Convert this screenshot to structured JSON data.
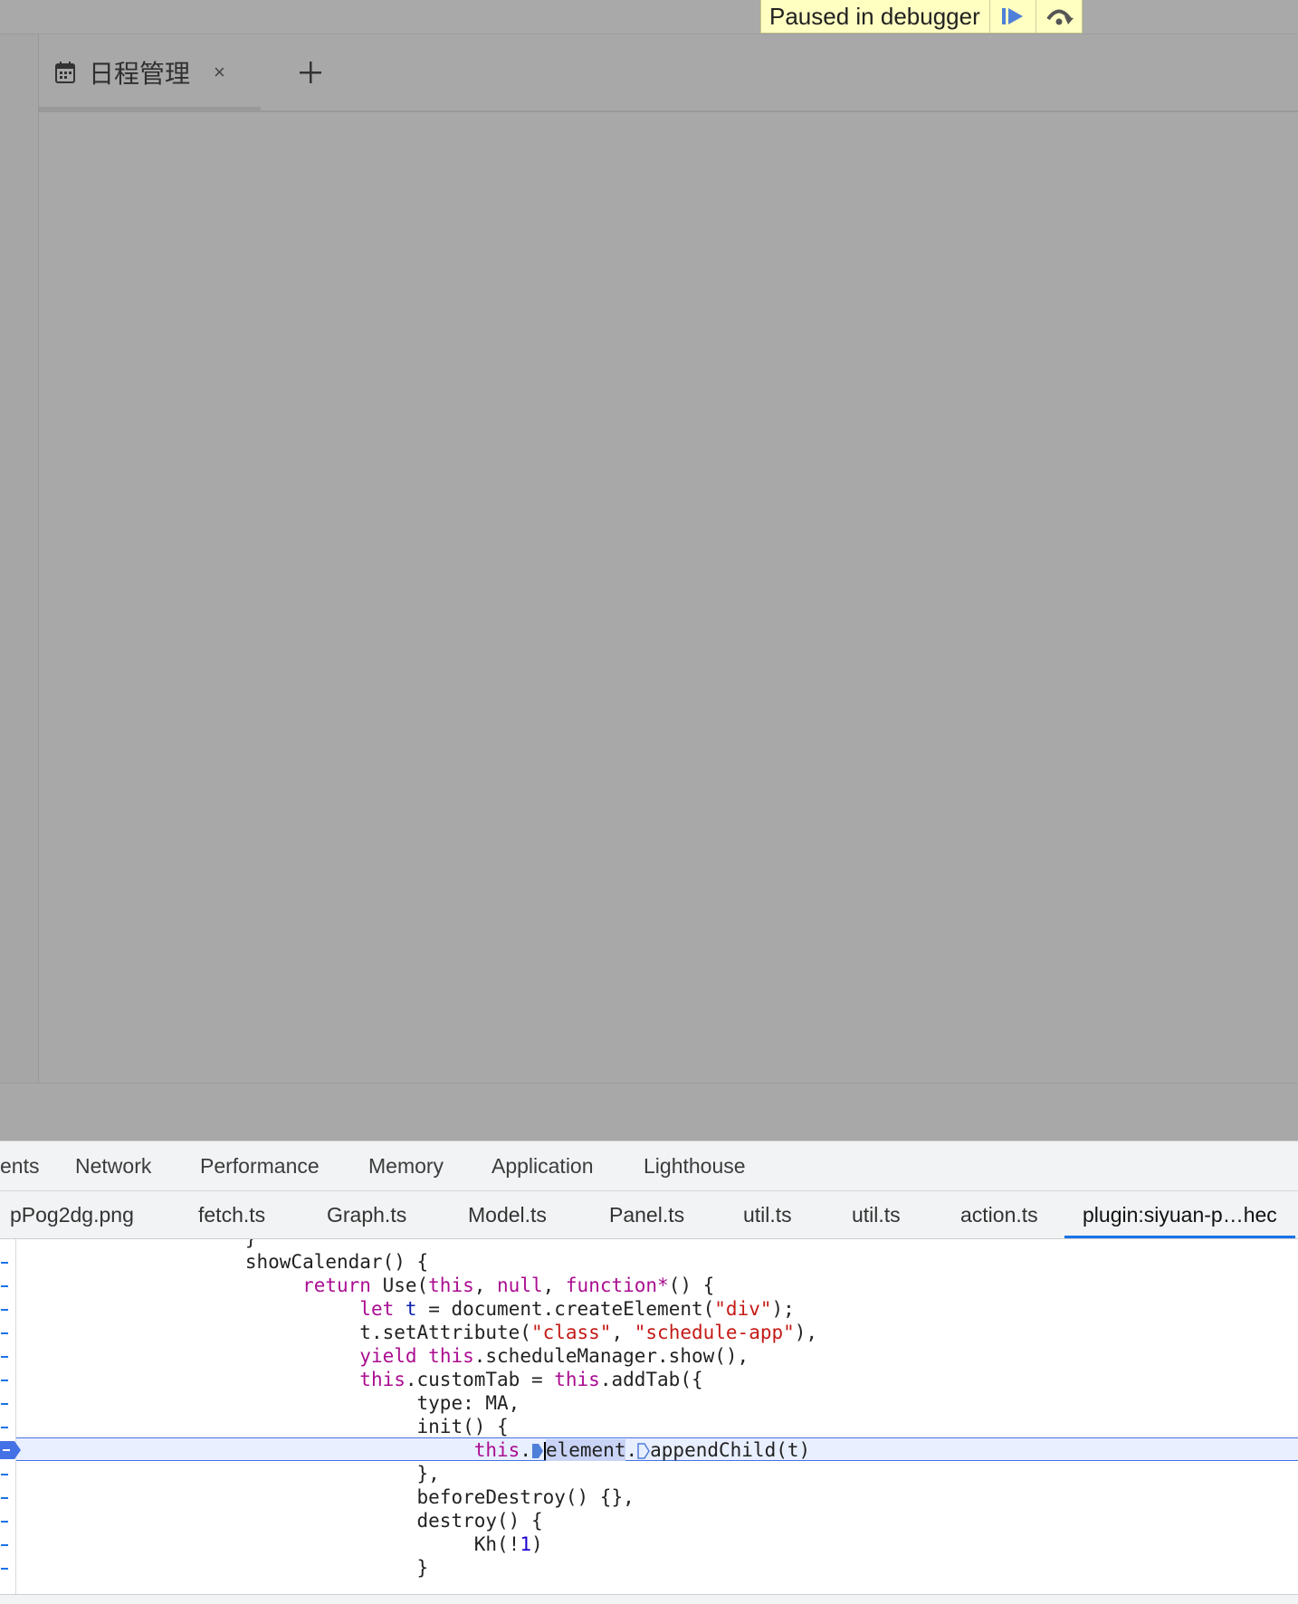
{
  "debugger_banner": {
    "label": "Paused in debugger",
    "resume_icon": "resume-icon",
    "step_over_icon": "step-over-icon"
  },
  "app": {
    "tab": {
      "icon": "calendar-icon",
      "title": "日程管理",
      "close": "×"
    },
    "add_tab": "+"
  },
  "devtools": {
    "panel_tabs": [
      "ents",
      "Network",
      "Performance",
      "Memory",
      "Application",
      "Lighthouse"
    ],
    "file_tabs": [
      "pPog2dg.png",
      "fetch.ts",
      "Graph.ts",
      "Model.ts",
      "Panel.ts",
      "util.ts",
      "util.ts",
      "action.ts",
      "plugin:siyuan-p…hec"
    ],
    "active_file_tab": "plugin:siyuan-p…hec",
    "code": {
      "l0": "                    }",
      "l1": "                    showCalendar() {",
      "l2_ret": "return",
      "l2_rest": " Use(",
      "l2_this": "this",
      "l2_comma": ", ",
      "l2_null": "null",
      "l2_comma2": ", ",
      "l2_fn": "function*",
      "l2_end": "() {",
      "l3_let": "let",
      "l3_t": "t",
      "l3_rest": " = document.createElement(",
      "l3_str": "\"div\"",
      "l3_end": ");",
      "l4_a": "t.setAttribute(",
      "l4_s1": "\"class\"",
      "l4_b": ", ",
      "l4_s2": "\"schedule-app\"",
      "l4_end": "),",
      "l5_yield": "yield",
      "l5_sp": " ",
      "l5_this": "this",
      "l5_rest": ".scheduleManager.show(),",
      "l6_this": "this",
      "l6_a": ".customTab = ",
      "l6_this2": "this",
      "l6_b": ".addTab({",
      "l7": "type: MA,",
      "l8": "init() {",
      "l9_this": "this",
      "l9_dot": ".",
      "l9_el": "element",
      "l9_dot2": ".",
      "l9_rest": "appendChild(t)",
      "l10": "},",
      "l11": "beforeDestroy() {},",
      "l12": "destroy() {",
      "l13_a": "Kh(!",
      "l13_num": "1",
      "l13_b": ")",
      "l14": "}"
    }
  }
}
